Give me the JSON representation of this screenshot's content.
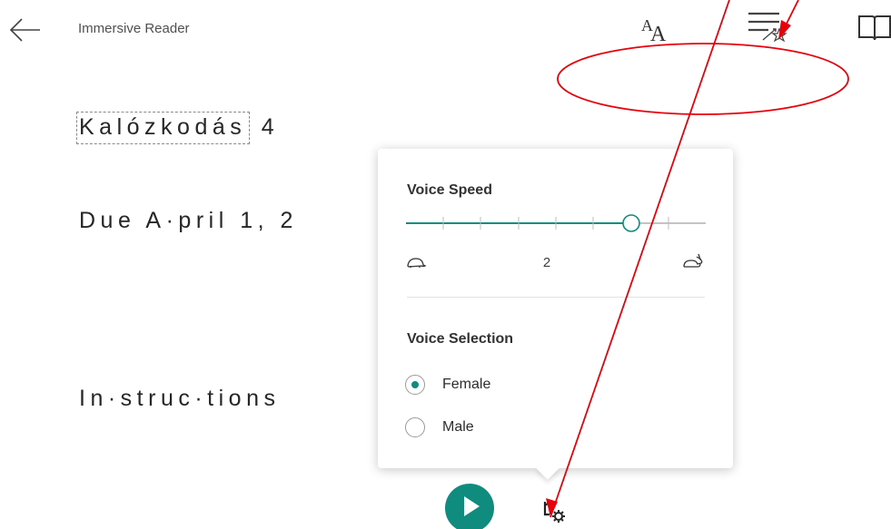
{
  "header": {
    "app_title": "Immersive Reader"
  },
  "toolbar": {
    "text_preferences_icon": "AA",
    "buttons": [
      "text-preferences",
      "grammar-options",
      "reading-preferences"
    ]
  },
  "document": {
    "line1_word": "Kalózkodás",
    "line1_rest": " 4",
    "line2": "Due A·pril 1, 2",
    "line3": "In·struc·tions"
  },
  "voice_settings": {
    "speed_title": "Voice Speed",
    "speed_value": "2",
    "speed_level": 0.75,
    "selection_title": "Voice Selection",
    "options": [
      {
        "label": "Female",
        "selected": true
      },
      {
        "label": "Male",
        "selected": false
      }
    ]
  },
  "colors": {
    "accent": "#0f8c7e",
    "annotation": "#e8000b"
  },
  "icons": [
    "back-arrow-icon",
    "text-preferences-icon",
    "grammar-options-icon",
    "reading-preferences-icon",
    "turtle-icon",
    "rabbit-icon",
    "play-icon",
    "voice-settings-icon"
  ]
}
